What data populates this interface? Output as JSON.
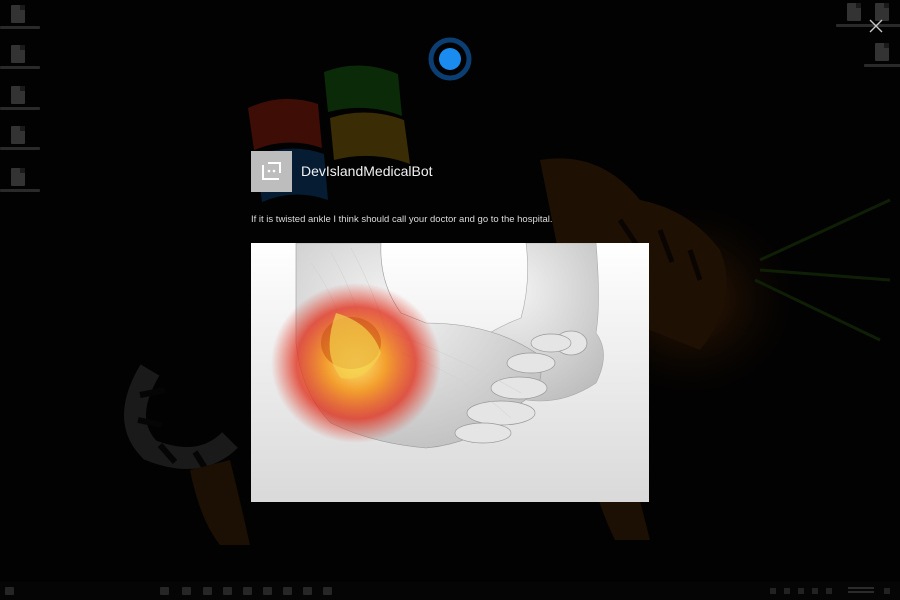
{
  "bot": {
    "name": "DevIslandMedicalBot",
    "message": "If it is twisted ankle I think should call your doctor and go to the hospital."
  },
  "icons": {
    "close": "close-icon",
    "cortana": "cortana-ring-icon",
    "avatar": "bot-avatar-icon"
  },
  "colors": {
    "cortana_blue": "#0a78d7",
    "background": "#000000",
    "text": "#f2f2f2"
  }
}
